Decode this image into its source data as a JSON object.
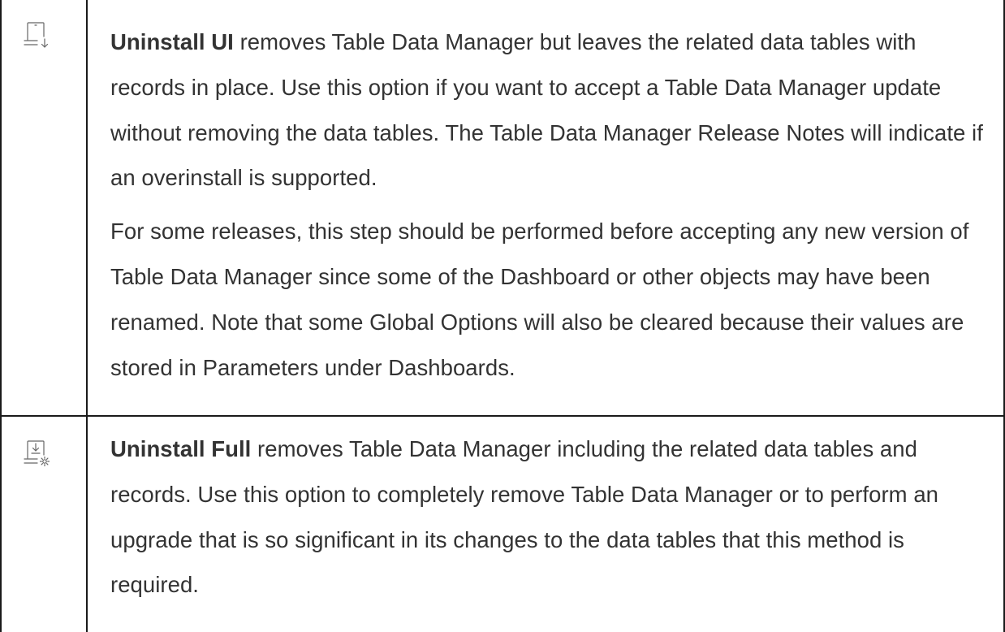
{
  "rows": [
    {
      "icon": "uninstall-ui-icon",
      "paragraphs": [
        {
          "term": "Uninstall UI",
          "text": " removes Table Data Manager but leaves the related data tables with records in place. Use this option if you want to accept a Table Data Manager update without removing the data tables. The Table Data Manager Release Notes will indicate if an overinstall is supported."
        },
        {
          "term": "",
          "text": "For some releases, this step should be performed before accepting any new version of Table Data Manager since some of the Dashboard or other objects may have been renamed. Note that some Global Options will also be cleared because their values are stored in Parameters under Dashboards."
        }
      ]
    },
    {
      "icon": "uninstall-full-icon",
      "paragraphs": [
        {
          "term": "Uninstall Full",
          "text": " removes Table Data Manager including the related data tables and records. Use this option to completely remove Table Data Manager or to perform an upgrade that is so significant in its changes to the data tables that this method is required."
        }
      ]
    }
  ],
  "colors": {
    "border": "#1a1a1a",
    "text": "#333333",
    "icon": "#666666"
  }
}
